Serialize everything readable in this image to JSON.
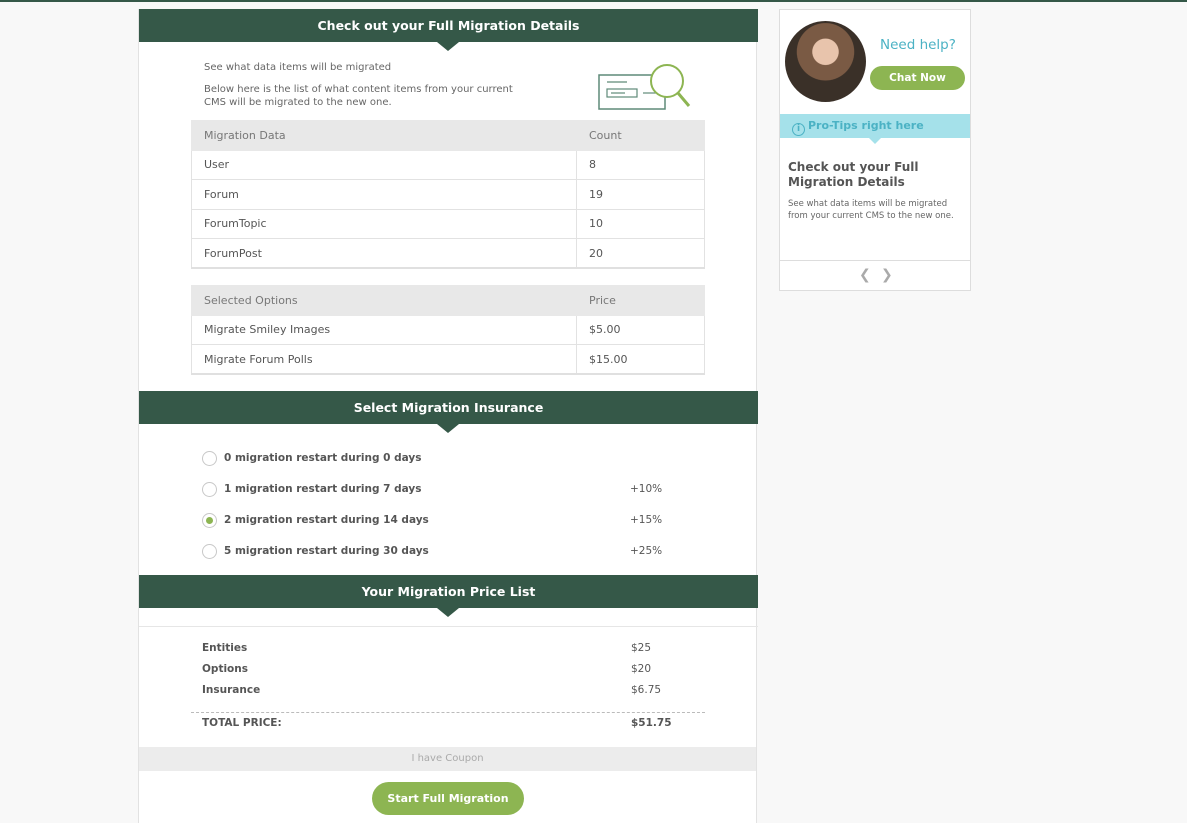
{
  "details": {
    "header": "Check out your Full Migration Details",
    "intro_line1": "See what data items will be migrated",
    "intro_line2": "Below here is the list of what content items from your current CMS will be migrated to the new one.",
    "data_table": {
      "headers": [
        "Migration Data",
        "Count"
      ],
      "rows": [
        [
          "User",
          "8"
        ],
        [
          "Forum",
          "19"
        ],
        [
          "ForumTopic",
          "10"
        ],
        [
          "ForumPost",
          "20"
        ]
      ]
    },
    "options_table": {
      "headers": [
        "Selected Options",
        "Price"
      ],
      "rows": [
        [
          "Migrate Smiley Images",
          "$5.00"
        ],
        [
          "Migrate Forum Polls",
          "$15.00"
        ]
      ]
    }
  },
  "insurance": {
    "header": "Select Migration Insurance",
    "options": [
      {
        "label": "0 migration restart during 0 days",
        "extra": "",
        "selected": false
      },
      {
        "label": "1 migration restart during 7 days",
        "extra": "+10%",
        "selected": false
      },
      {
        "label": "2 migration restart during 14 days",
        "extra": "+15%",
        "selected": true
      },
      {
        "label": "5 migration restart during 30 days",
        "extra": "+25%",
        "selected": false
      }
    ]
  },
  "price_list": {
    "header": "Your Migration Price List",
    "items": [
      {
        "label": "Entities",
        "value": "$25"
      },
      {
        "label": "Options",
        "value": "$20"
      },
      {
        "label": "Insurance",
        "value": "$6.75"
      }
    ],
    "total_label": "TOTAL PRICE:",
    "total_value": "$51.75",
    "coupon_label": "I have Coupon",
    "start_button": "Start Full Migration"
  },
  "help": {
    "title": "Need help?",
    "chat_button": "Chat Now",
    "protips_label": "Pro-Tips right here",
    "tip_title": "Check out your Full Migration Details",
    "tip_body": "See what data items will be migrated from your current CMS to the new one."
  },
  "colors": {
    "header_bg": "#355848",
    "accent_green": "#8db552",
    "help_teal": "#4bb2c4",
    "tips_bg": "#a5e1ea"
  },
  "icons": [
    "migration-illustration-icon",
    "info-icon",
    "chevron-left-icon",
    "chevron-right-icon"
  ]
}
